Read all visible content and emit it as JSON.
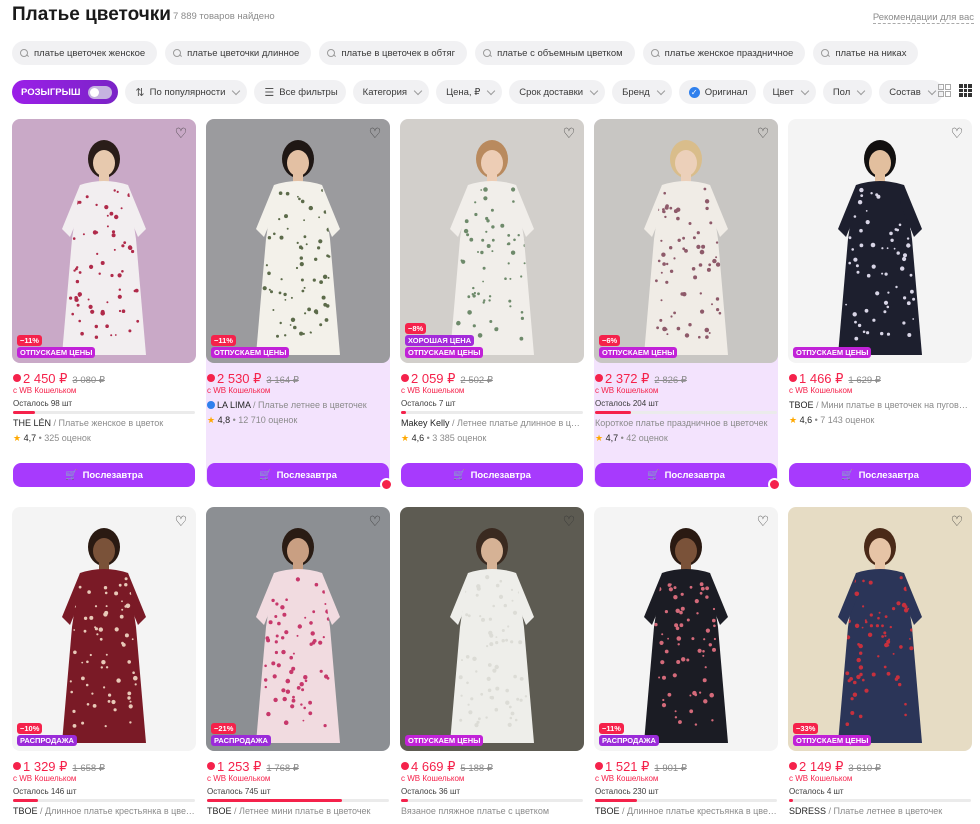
{
  "header": {
    "title": "Платье цветочки",
    "count": "7 889 товаров найдено",
    "recommendations": "Рекомендации для вас"
  },
  "chips": [
    "платье цветочек женское",
    "платье цветочки длинное",
    "платье в цветочек в обтяг",
    "платье с объемным цветком",
    "платье женское праздничное",
    "платье на никах"
  ],
  "filters": {
    "raffle": "РОЗЫГРЫШ",
    "sort": "По популярности",
    "all": "Все фильтры",
    "category": "Категория",
    "price": "Цена, ₽",
    "delivery": "Срок доставки",
    "brand": "Бренд",
    "original": "Оригинал",
    "color": "Цвет",
    "gender": "Пол",
    "composition": "Состав"
  },
  "colors": {
    "accent": "#a73afd",
    "price": "#f5224b",
    "promo_bg": "#f3e3fd"
  },
  "products": [
    {
      "discount": "−11%",
      "label": "ОТПУСКАЕМ ЦЕНЫ",
      "label2": "",
      "price": "2 450 ₽",
      "old": "3 080 ₽",
      "wallet": "с WB Кошельком",
      "stock": "Осталось 98 шт",
      "stock_pct": 12,
      "brand": "THE LÉN",
      "title": "Платье женское в цветок",
      "rating": "4,7",
      "reviews": "325 оценок",
      "buy": "Послезавтра",
      "promo": false,
      "bg": "#c9a9c7",
      "dress": "#f2eef0",
      "dot": "#b02a4a",
      "skin": "#e7c9ae",
      "hair": "#2a1d19"
    },
    {
      "discount": "−11%",
      "label": "ОТПУСКАЕМ ЦЕНЫ",
      "label2": "",
      "price": "2 530 ₽",
      "old": "3 164 ₽",
      "wallet": "с WB Кошельком",
      "stock": "",
      "stock_pct": null,
      "brand": "LA LIMA",
      "title": "Платье летнее в цветочек",
      "rating": "4,8",
      "reviews": "12 710 оценок",
      "buy": "Послезавтра",
      "promo": true,
      "verified": true,
      "bg": "#9b9b9e",
      "dress": "#f3f1ea",
      "dot": "#5c6b4a",
      "skin": "#e3c0a3",
      "hair": "#1f1714"
    },
    {
      "discount": "−8%",
      "label": "ОТПУСКАЕМ ЦЕНЫ",
      "label2": "ХОРОШАЯ ЦЕНА",
      "price": "2 059 ₽",
      "old": "2 502 ₽",
      "wallet": "с WB Кошельком",
      "stock": "Осталось 7 шт",
      "stock_pct": 3,
      "brand": "Makey Kelly",
      "title": "Летнее платье длинное в цветочек",
      "rating": "4,6",
      "reviews": "3 385 оценок",
      "buy": "Послезавтра",
      "promo": false,
      "bg": "#d2cfcb",
      "dress": "#f1eeea",
      "dot": "#6e8a6b",
      "skin": "#edcdb5",
      "hair": "#b98a5e"
    },
    {
      "discount": "−6%",
      "label": "ОТПУСКАЕМ ЦЕНЫ",
      "label2": "",
      "price": "2 372 ₽",
      "old": "2 826 ₽",
      "wallet": "с WB Кошельком",
      "stock": "Осталось 204 шт",
      "stock_pct": 20,
      "brand": "",
      "title": "Короткое платье праздничное в цветочек",
      "rating": "4,7",
      "reviews": "42 оценок",
      "buy": "Послезавтра",
      "promo": true,
      "bg": "#c8c6c3",
      "dress": "#f0ece6",
      "dot": "#8e5a6a",
      "skin": "#ecd0ba",
      "hair": "#d9bd8b"
    },
    {
      "discount": "",
      "label": "ОТПУСКАЕМ ЦЕНЫ",
      "label2": "",
      "price": "1 466 ₽",
      "old": "1 629 ₽",
      "wallet": "с WB Кошельком",
      "stock": "",
      "stock_pct": null,
      "brand": "TBOE",
      "title": "Мини платье в цветочек на пуговицах",
      "rating": "4,6",
      "reviews": "7 143 оценок",
      "buy": "Послезавтра",
      "promo": false,
      "bg": "#f4f4f4",
      "dress": "#1d1f2e",
      "dot": "#d8d5e6",
      "skin": "#e2bf9e",
      "hair": "#121010"
    },
    {
      "discount": "−10%",
      "label": "РАСПРОДАЖА",
      "label2": "",
      "price": "1 329 ₽",
      "old": "1 658 ₽",
      "wallet": "с WB Кошельком",
      "stock": "Осталось 146 шт",
      "stock_pct": 14,
      "brand": "TBOE",
      "title": "Длинное платье крестьянка в цветочек",
      "promo": false,
      "bg": "#f4f4f4",
      "dress": "#7a1a26",
      "dot": "#e8c9b8",
      "skin": "#7a5239",
      "hair": "#2a1a12"
    },
    {
      "discount": "−21%",
      "label": "РАСПРОДАЖА",
      "label2": "",
      "price": "1 253 ₽",
      "old": "1 768 ₽",
      "wallet": "с WB Кошельком",
      "stock": "Осталось 745 шт",
      "stock_pct": 74,
      "brand": "TBOE",
      "title": "Летнее мини платье в цветочек",
      "promo": false,
      "bg": "#8c8f93",
      "dress": "#f1dbe0",
      "dot": "#c7386b",
      "skin": "#c99f82",
      "hair": "#2a1c14"
    },
    {
      "discount": "",
      "label": "ОТПУСКАЕМ ЦЕНЫ",
      "label2": "",
      "price": "4 669 ₽",
      "old": "5 188 ₽",
      "wallet": "с WB Кошельком",
      "stock": "Осталось 36 шт",
      "stock_pct": 4,
      "brand": "",
      "title": "Вязаное пляжное платье с цветком",
      "promo": false,
      "bg": "#5d5b52",
      "dress": "#eeeeea",
      "dot": "#dcdcd6",
      "skin": "#d6b295",
      "hair": "#3a2a20"
    },
    {
      "discount": "−11%",
      "label": "РАСПРОДАЖА",
      "label2": "",
      "price": "1 521 ₽",
      "old": "1 901 ₽",
      "wallet": "с WB Кошельком",
      "stock": "Осталось 230 шт",
      "stock_pct": 23,
      "brand": "TBOE",
      "title": "Длинное платье крестьянка в цветочек",
      "promo": false,
      "bg": "#f4f4f4",
      "dress": "#1b1c24",
      "dot": "#d46a7a",
      "skin": "#7a5239",
      "hair": "#2a1a12"
    },
    {
      "discount": "−33%",
      "label": "ОТПУСКАЕМ ЦЕНЫ",
      "label2": "",
      "price": "2 149 ₽",
      "old": "3 610 ₽",
      "wallet": "с WB Кошельком",
      "stock": "Осталось 4 шт",
      "stock_pct": 1,
      "brand": "SDRESS",
      "title": "Платье летнее в цветочек",
      "promo": false,
      "bg": "#e6dcc4",
      "dress": "#2b3558",
      "dot": "#c7303d",
      "skin": "#e6c4a6",
      "hair": "#4a2a18"
    }
  ]
}
